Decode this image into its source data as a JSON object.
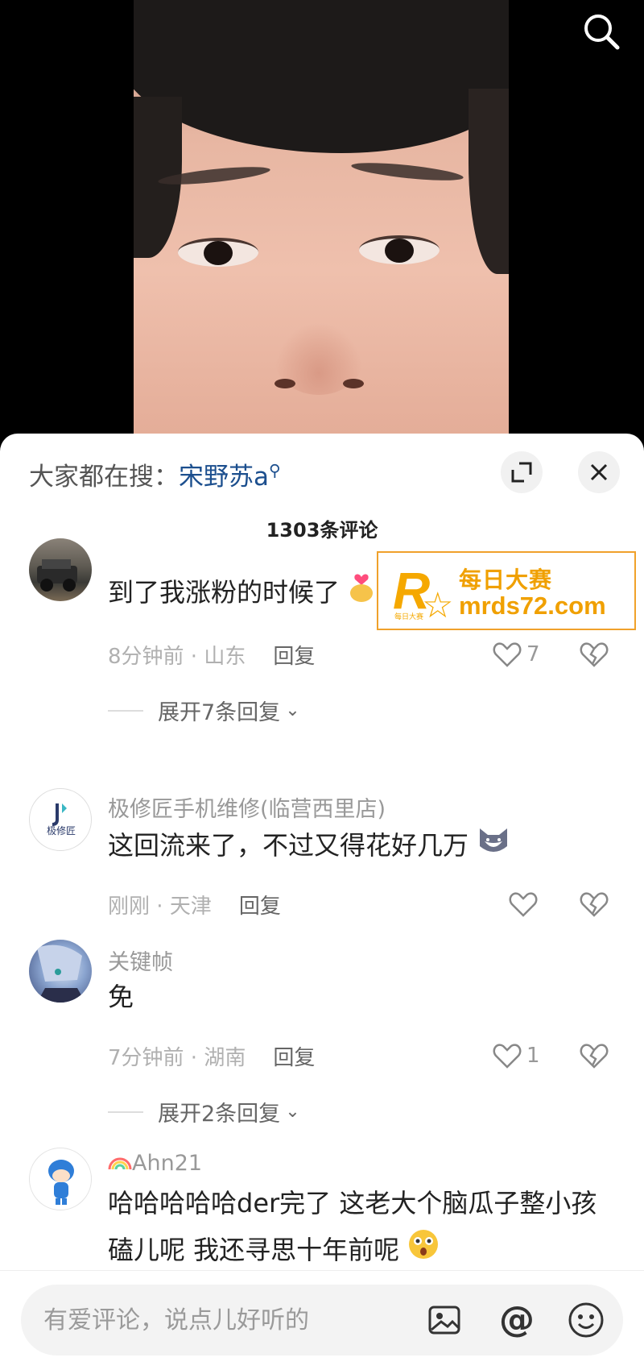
{
  "hot_search": {
    "prefix": "大家都在搜：",
    "term": "宋野苏a"
  },
  "comment_count": "1303条评论",
  "ad": {
    "title": "每日大赛",
    "url": "mrds72.com",
    "logo_letter": "R",
    "logo_small": "每日大赛"
  },
  "comments": [
    {
      "username": "",
      "text": "到了我涨粉的时候了",
      "time": "8分钟前",
      "location": "山东",
      "reply_label": "回复",
      "likes": "7",
      "expand": "展开7条回复"
    },
    {
      "username": "极修匠手机维修(临营西里店)",
      "avatar_text": "极修匠",
      "text": "这回流来了，不过又得花好几万",
      "time": "刚刚",
      "location": "天津",
      "reply_label": "回复",
      "likes": ""
    },
    {
      "username": "关键帧",
      "text": "免",
      "time": "7分钟前",
      "location": "湖南",
      "reply_label": "回复",
      "likes": "1",
      "expand": "展开2条回复"
    },
    {
      "username": "Ahn21",
      "text_line1": "哈哈哈哈哈der完了 这老大个脑瓜子整小孩",
      "text_line2": "磕儿呢 我还寻思十年前呢"
    }
  ],
  "input": {
    "placeholder": "有爱评论，说点儿好听的",
    "at_symbol": "@"
  },
  "separator": " · ",
  "colors": {
    "accent": "#1c4f8e",
    "ad_orange": "#f0a000"
  }
}
